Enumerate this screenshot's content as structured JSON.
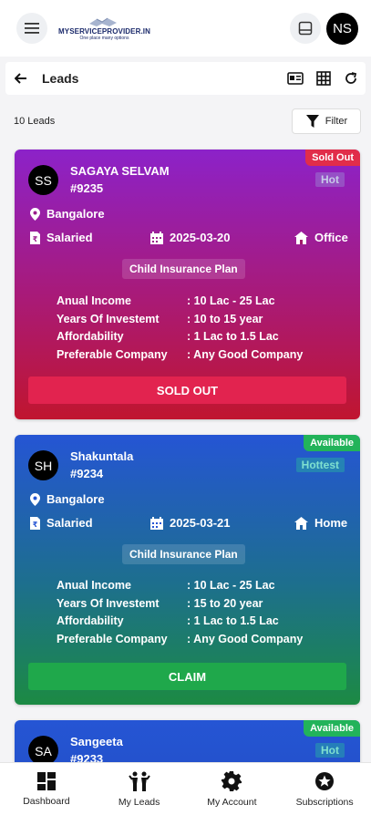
{
  "app": {
    "logo_title": "MYSERVICEPROVIDER.IN",
    "logo_tagline": "One place many options",
    "user_initials": "NS"
  },
  "page": {
    "title": "Leads",
    "lead_count": "10 Leads",
    "filter_label": "Filter"
  },
  "colors": {
    "sold_out": "#e12d4a",
    "available": "#22b35a",
    "claim": "#1fa84b"
  },
  "leads": [
    {
      "initials": "SS",
      "name": "SAGAYA SELVAM",
      "id": "#9235",
      "status": "Sold Out",
      "temperature": "Hot",
      "city": "Bangalore",
      "employment": "Salaried",
      "date": "2025-03-20",
      "workplace": "Office",
      "plan": "Child Insurance Plan",
      "details": [
        {
          "label": "Anual Income",
          "value": ": 10 Lac - 25 Lac"
        },
        {
          "label": "Years Of Investemt",
          "value": ": 10 to 15 year"
        },
        {
          "label": "Affordability",
          "value": ": 1 Lac to 1.5 Lac"
        },
        {
          "label": "Preferable Company",
          "value": ": Any Good Company"
        }
      ],
      "action": "SOLD OUT"
    },
    {
      "initials": "SH",
      "name": "Shakuntala",
      "id": "#9234",
      "status": "Available",
      "temperature": "Hottest",
      "city": "Bangalore",
      "employment": "Salaried",
      "date": "2025-03-21",
      "workplace": "Home",
      "plan": "Child Insurance Plan",
      "details": [
        {
          "label": "Anual Income",
          "value": ": 10 Lac - 25 Lac"
        },
        {
          "label": "Years Of Investemt",
          "value": ": 15 to 20 year"
        },
        {
          "label": "Affordability",
          "value": ": 1 Lac to 1.5 Lac"
        },
        {
          "label": "Preferable Company",
          "value": ": Any Good Company"
        }
      ],
      "action": "CLAIM"
    },
    {
      "initials": "SA",
      "name": "Sangeeta",
      "id": "#9233",
      "status": "Available",
      "temperature": "Hot"
    }
  ],
  "nav": [
    {
      "label": "Dashboard",
      "icon": "dashboard-icon"
    },
    {
      "label": "My Leads",
      "icon": "people-icon"
    },
    {
      "label": "My Account",
      "icon": "gear-icon"
    },
    {
      "label": "Subscriptions",
      "icon": "star-badge-icon"
    }
  ]
}
